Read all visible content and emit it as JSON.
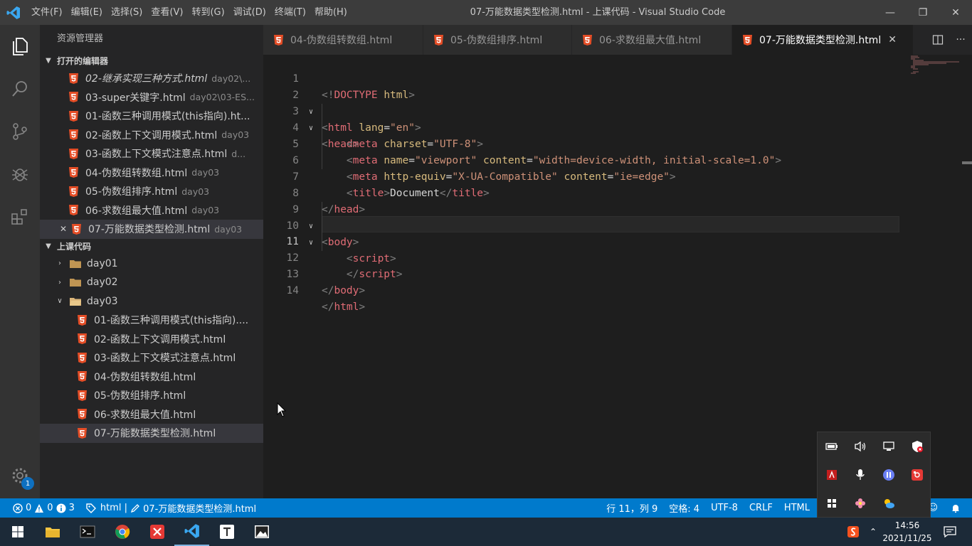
{
  "titlebar": {
    "menu": [
      "文件(F)",
      "编辑(E)",
      "选择(S)",
      "查看(V)",
      "转到(G)",
      "调试(D)",
      "终端(T)",
      "帮助(H)"
    ],
    "title": "07-万能数据类型检测.html - 上课代码 - Visual Studio Code"
  },
  "sidebar": {
    "title": "资源管理器",
    "open_editors_label": "打开的编辑器",
    "open_editors": [
      {
        "name": "02-继承实现三种方式.html",
        "desc": "day02\\..."
      },
      {
        "name": "03-super关键字.html",
        "desc": "day02\\03-ES..."
      },
      {
        "name": "01-函数三种调用模式(this指向).ht...",
        "desc": ""
      },
      {
        "name": "02-函数上下文调用模式.html",
        "desc": "day03"
      },
      {
        "name": "03-函数上下文模式注意点.html",
        "desc": "d..."
      },
      {
        "name": "04-伪数组转数组.html",
        "desc": "day03"
      },
      {
        "name": "05-伪数组排序.html",
        "desc": "day03"
      },
      {
        "name": "06-求数组最大值.html",
        "desc": "day03"
      },
      {
        "name": "07-万能数据类型检测.html",
        "desc": "day03"
      }
    ],
    "workspace_label": "上课代码",
    "folders": [
      "day01",
      "day02",
      "day03"
    ],
    "day03_files": [
      "01-函数三种调用模式(this指向)....",
      "02-函数上下文调用模式.html",
      "03-函数上下文模式注意点.html",
      "04-伪数组转数组.html",
      "05-伪数组排序.html",
      "06-求数组最大值.html",
      "07-万能数据类型检测.html"
    ]
  },
  "tabs": [
    {
      "label": "04-伪数组转数组.html"
    },
    {
      "label": "05-伪数组排序.html"
    },
    {
      "label": "06-求数组最大值.html"
    },
    {
      "label": "07-万能数据类型检测.html"
    }
  ],
  "editor": {
    "line_numbers": [
      "1",
      "2",
      "3",
      "4",
      "5",
      "6",
      "7",
      "8",
      "9",
      "10",
      "11",
      "12",
      "13",
      "14"
    ],
    "current_line": "11"
  },
  "statusbar": {
    "errors": "0",
    "warnings": "0",
    "infos": "3",
    "breadcrumb": "html | ",
    "file": "07-万能数据类型检测.html",
    "position": "行 11，列 9",
    "spaces": "空格: 4",
    "encoding": "UTF-8",
    "eol": "CRLF",
    "language": "HTML"
  },
  "activity": {
    "badge": "1"
  },
  "taskbar": {
    "time": "14:56",
    "date": "2021/11/25"
  },
  "colors": {
    "accent": "#007acc",
    "html_icon": "#e44d26"
  }
}
